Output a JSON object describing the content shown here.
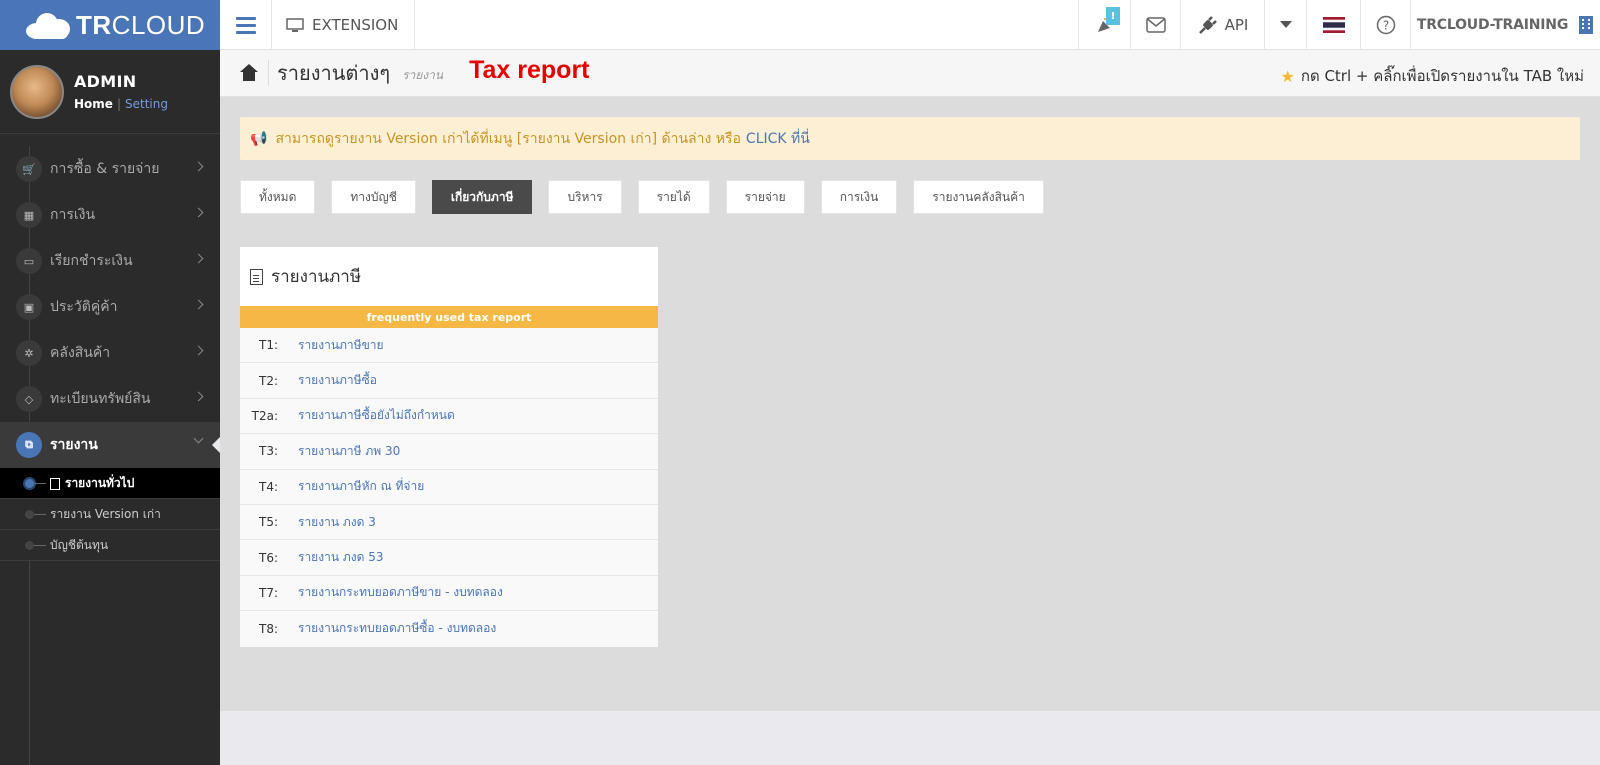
{
  "brand": {
    "name_bold": "TR",
    "name_light": "CLOUD"
  },
  "topbar": {
    "extension_label": "EXTENSION",
    "notification_badge": "!",
    "api_label": "API",
    "company_name": "TRCLOUD-TRAINING"
  },
  "profile": {
    "name": "ADMIN",
    "home_link": "Home",
    "separator": "|",
    "setting_link": "Setting"
  },
  "sidebar": {
    "items": [
      {
        "label": "การซื้อ & รายจ่าย",
        "icon": "🛒"
      },
      {
        "label": "การเงิน",
        "icon": "▦"
      },
      {
        "label": "เรียกชำระเงิน",
        "icon": "▭"
      },
      {
        "label": "ประวัติคู่ค้า",
        "icon": "▣"
      },
      {
        "label": "คลังสินค้า",
        "icon": "✲"
      },
      {
        "label": "ทะเบียนทรัพย์สิน",
        "icon": "◇"
      },
      {
        "label": "รายงาน",
        "icon": "⧉"
      }
    ],
    "subitems": [
      {
        "label": "รายงานทั่วไป"
      },
      {
        "label": "รายงาน Version เก่า"
      },
      {
        "label": "บัญชีต้นทุน"
      }
    ]
  },
  "header": {
    "title": "รายงานต่างๆ",
    "subtitle": "รายงาน",
    "annotation": "Tax report",
    "hint": "กด Ctrl + คลิ๊กเพื่อเปิดรายงานใน TAB ใหม่"
  },
  "notice": {
    "text": "สามารถดูรายงาน Version เก่าได้ที่เมนู [รายงาน Version เก่า] ด้านล่าง หรือ",
    "link_text": "CLICK ที่นี่"
  },
  "tabs": [
    {
      "label": "ทั้งหมด",
      "active": false
    },
    {
      "label": "ทางบัญชี",
      "active": false
    },
    {
      "label": "เกี่ยวกับภาษี",
      "active": true
    },
    {
      "label": "บริหาร",
      "active": false
    },
    {
      "label": "รายได้",
      "active": false
    },
    {
      "label": "รายจ่าย",
      "active": false
    },
    {
      "label": "การเงิน",
      "active": false
    },
    {
      "label": "รายงานคลังสินค้า",
      "active": false
    }
  ],
  "card": {
    "title": "รายงานภาษี",
    "band": "frequently used tax report",
    "rows": [
      {
        "code": "T1:",
        "label": "รายงานภาษีขาย"
      },
      {
        "code": "T2:",
        "label": "รายงานภาษีซื้อ"
      },
      {
        "code": "T2a:",
        "label": "รายงานภาษีซื้อยังไม่ถึงกำหนด"
      },
      {
        "code": "T3:",
        "label": "รายงานภาษี ภพ 30"
      },
      {
        "code": "T4:",
        "label": "รายงานภาษีหัก ณ ที่จ่าย"
      },
      {
        "code": "T5:",
        "label": "รายงาน ภงด 3"
      },
      {
        "code": "T6:",
        "label": "รายงาน ภงด 53"
      },
      {
        "code": "T7:",
        "label": "รายงานกระทบยอดภาษีขาย - งบทดลอง"
      },
      {
        "code": "T8:",
        "label": "รายงานกระทบยอดภาษีซื้อ - งบทดลอง"
      }
    ]
  },
  "colors": {
    "brand": "#4a76b7",
    "accent_orange": "#f5b845",
    "annotation_red": "#e60000",
    "notice_bg": "#fcefd3"
  }
}
